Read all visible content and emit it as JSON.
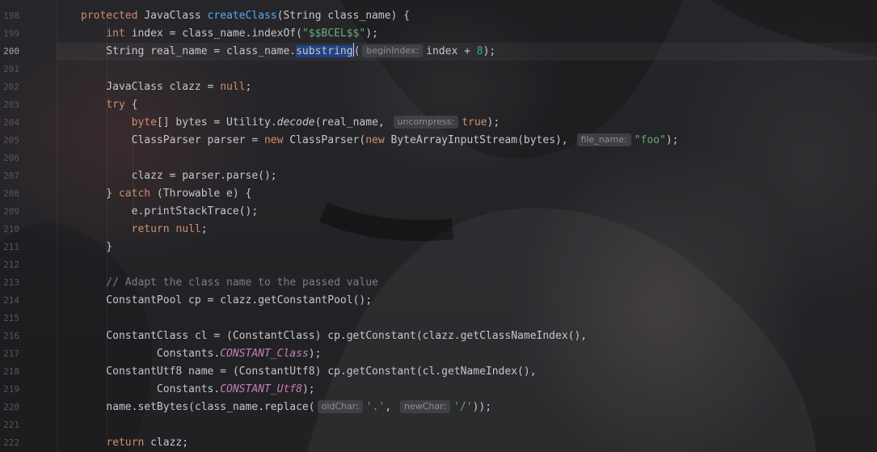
{
  "editor": {
    "theme": {
      "keyword": "#cf8e6d",
      "function": "#56a8f5",
      "string": "#6aab73",
      "number": "#2aacb8",
      "comment": "#7a7e85",
      "constant": "#c77dbb",
      "selection": "#214283"
    },
    "current_line": "200",
    "lines": [
      {
        "num": "198",
        "tokens": [
          {
            "t": "protected",
            "k": "kw"
          },
          {
            "t": " JavaClass "
          },
          {
            "t": "createClass",
            "k": "fn"
          },
          {
            "t": "(String class_name) {"
          }
        ]
      },
      {
        "num": "199",
        "tokens": [
          {
            "t": "    "
          },
          {
            "t": "int",
            "k": "kw"
          },
          {
            "t": " index = class_name.indexOf("
          },
          {
            "t": "\"$$BCEL$$\"",
            "k": "str"
          },
          {
            "t": ");"
          }
        ]
      },
      {
        "num": "200",
        "tokens": [
          {
            "t": "    String real_name = class_name."
          },
          {
            "t": "substring",
            "k": "sel"
          },
          {
            "k": "caret"
          },
          {
            "t": "("
          },
          {
            "hint": "beginIndex:"
          },
          {
            "t": "index + "
          },
          {
            "t": "8",
            "k": "num"
          },
          {
            "t": ");"
          }
        ]
      },
      {
        "num": "201",
        "tokens": []
      },
      {
        "num": "202",
        "tokens": [
          {
            "t": "    JavaClass clazz = "
          },
          {
            "t": "null",
            "k": "kw"
          },
          {
            "t": ";"
          }
        ]
      },
      {
        "num": "203",
        "tokens": [
          {
            "t": "    "
          },
          {
            "t": "try",
            "k": "kw"
          },
          {
            "t": " {"
          }
        ]
      },
      {
        "num": "204",
        "tokens": [
          {
            "t": "        "
          },
          {
            "t": "byte",
            "k": "kw"
          },
          {
            "t": "[] bytes = Utility."
          },
          {
            "t": "decode",
            "k": "ital"
          },
          {
            "t": "(real_name, "
          },
          {
            "hint": "uncompress:"
          },
          {
            "t": "true",
            "k": "kw"
          },
          {
            "t": ");"
          }
        ]
      },
      {
        "num": "205",
        "tokens": [
          {
            "t": "        ClassParser parser = "
          },
          {
            "t": "new",
            "k": "kw"
          },
          {
            "t": " ClassParser("
          },
          {
            "t": "new",
            "k": "kw"
          },
          {
            "t": " ByteArrayInputStream(bytes), "
          },
          {
            "hint": "file_name:"
          },
          {
            "t": "\"foo\"",
            "k": "str"
          },
          {
            "t": ");"
          }
        ]
      },
      {
        "num": "206",
        "tokens": []
      },
      {
        "num": "207",
        "tokens": [
          {
            "t": "        clazz = parser.parse();"
          }
        ]
      },
      {
        "num": "208",
        "tokens": [
          {
            "t": "    } "
          },
          {
            "t": "catch",
            "k": "kw"
          },
          {
            "t": " (Throwable e) {"
          }
        ]
      },
      {
        "num": "209",
        "tokens": [
          {
            "t": "        e.printStackTrace();"
          }
        ]
      },
      {
        "num": "210",
        "tokens": [
          {
            "t": "        "
          },
          {
            "t": "return",
            "k": "kw"
          },
          {
            "t": " "
          },
          {
            "t": "null",
            "k": "kw"
          },
          {
            "t": ";"
          }
        ]
      },
      {
        "num": "211",
        "tokens": [
          {
            "t": "    }"
          }
        ]
      },
      {
        "num": "212",
        "tokens": []
      },
      {
        "num": "213",
        "tokens": [
          {
            "t": "    // Adapt the class name to the passed value",
            "k": "cmt"
          }
        ]
      },
      {
        "num": "214",
        "tokens": [
          {
            "t": "    ConstantPool cp = clazz.getConstantPool();"
          }
        ]
      },
      {
        "num": "215",
        "tokens": []
      },
      {
        "num": "216",
        "tokens": [
          {
            "t": "    ConstantClass cl = (ConstantClass) cp.getConstant(clazz.getClassNameIndex(),"
          }
        ]
      },
      {
        "num": "217",
        "tokens": [
          {
            "t": "            Constants."
          },
          {
            "t": "CONSTANT_Class",
            "k": "const"
          },
          {
            "t": ");"
          }
        ]
      },
      {
        "num": "218",
        "tokens": [
          {
            "t": "    ConstantUtf8 name = (ConstantUtf8) cp.getConstant(cl.getNameIndex(),"
          }
        ]
      },
      {
        "num": "219",
        "tokens": [
          {
            "t": "            Constants."
          },
          {
            "t": "CONSTANT_Utf8",
            "k": "const"
          },
          {
            "t": ");"
          }
        ]
      },
      {
        "num": "220",
        "tokens": [
          {
            "t": "    name.setBytes(class_name.replace("
          },
          {
            "hint": "oldChar:"
          },
          {
            "t": "'.'",
            "k": "str"
          },
          {
            "t": ", "
          },
          {
            "hint": "newChar:"
          },
          {
            "t": "'/'",
            "k": "str"
          },
          {
            "t": "));"
          }
        ]
      },
      {
        "num": "221",
        "tokens": []
      },
      {
        "num": "222",
        "tokens": [
          {
            "t": "    "
          },
          {
            "t": "return",
            "k": "kw"
          },
          {
            "t": " clazz;"
          }
        ]
      }
    ]
  }
}
